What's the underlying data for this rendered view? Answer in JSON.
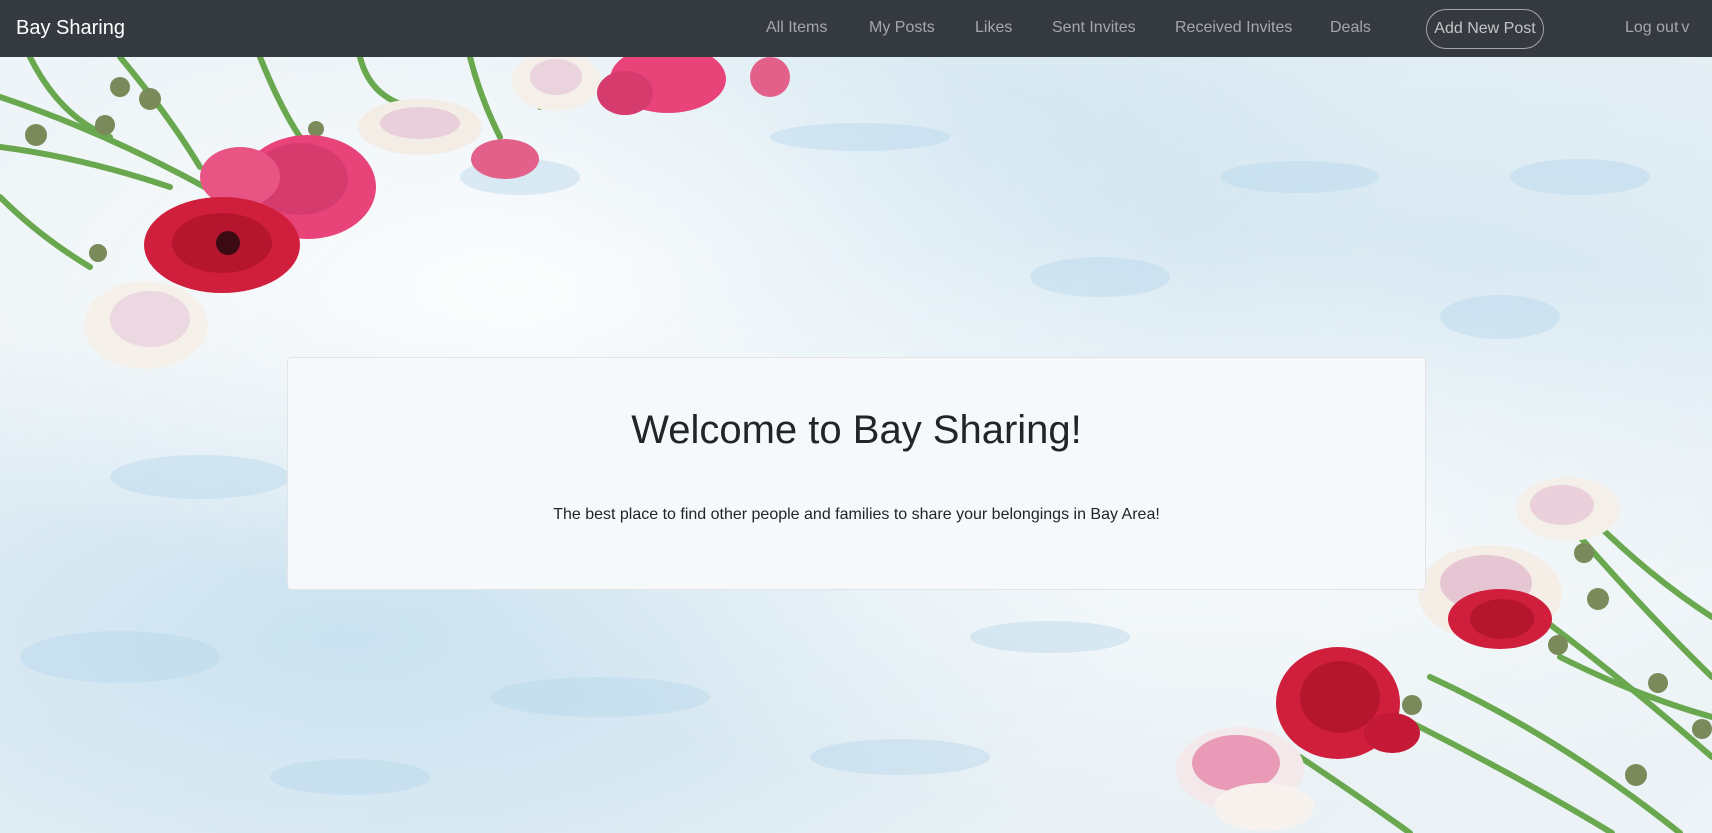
{
  "navbar": {
    "brand": "Bay Sharing",
    "links": {
      "all_items": "All Items",
      "my_posts": "My Posts",
      "likes": "Likes",
      "sent_invites": "Sent Invites",
      "received_invites": "Received Invites",
      "deals": "Deals"
    },
    "add_post_label": "Add New Post",
    "logout_label": "Log out",
    "logout_caret": "v"
  },
  "welcome": {
    "title": "Welcome to Bay Sharing!",
    "subtitle": "The best place to find other people and families to share your belongings in Bay Area!"
  },
  "colors": {
    "navbar_bg": "#343a40",
    "card_bg": "#f7f8fa",
    "text": "#212529",
    "flower_red": "#d01f3c",
    "flower_pink": "#e8447a"
  },
  "icons": [
    "caret-down-icon"
  ]
}
